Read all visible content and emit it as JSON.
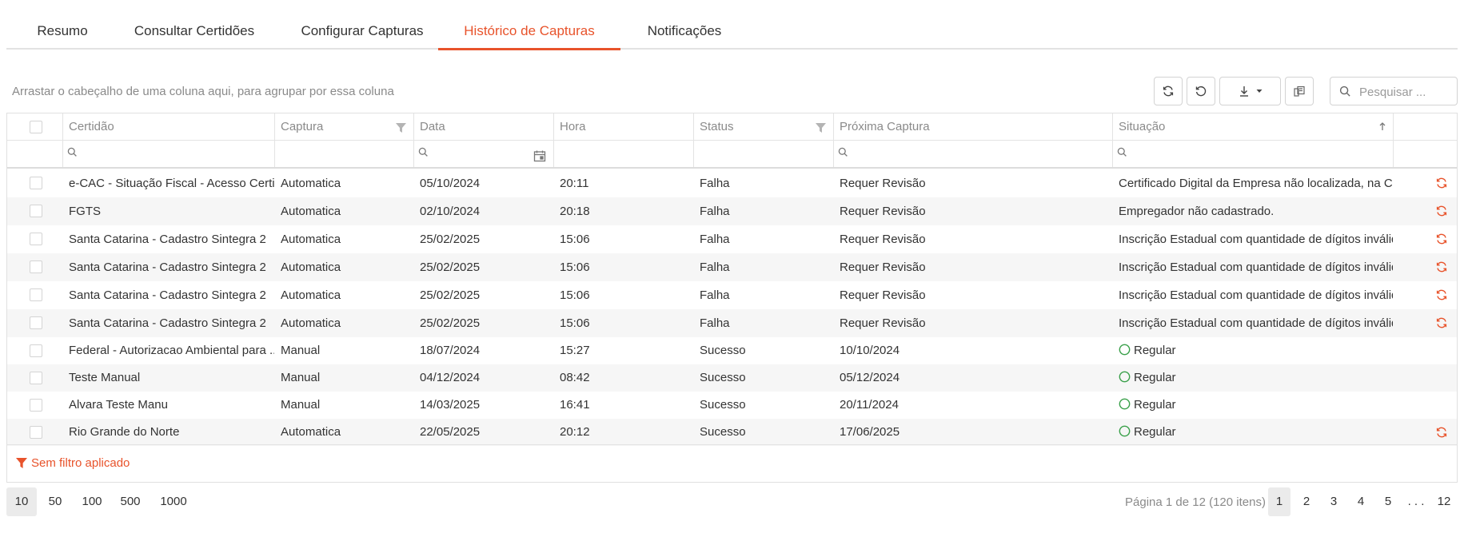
{
  "tabs": [
    "Resumo",
    "Consultar Certidões",
    "Configurar Capturas",
    "Histórico de Capturas",
    "Notificações"
  ],
  "active_tab": "Histórico de Capturas",
  "accent_color": "#e8532b",
  "toolbar": {
    "group_hint": "Arrastar o cabeçalho de uma coluna aqui, para agrupar por essa coluna",
    "search_placeholder": "Pesquisar ...",
    "buttons": [
      "refresh-icon",
      "reset-icon",
      "download-icon",
      "column-chooser-icon"
    ]
  },
  "grid": {
    "columns": [
      "Certidão",
      "Captura",
      "Data",
      "Hora",
      "Status",
      "Próxima Captura",
      "Situação"
    ],
    "rows": [
      {
        "certidao": "e-CAC - Situação Fiscal - Acesso Certif...",
        "captura": "Automatica",
        "data": "05/10/2024",
        "hora": "20:11",
        "status": "Falha",
        "proxima": "Requer Revisão",
        "situacao": "Certificado Digital da Empresa não localizada, na Ce...",
        "regular": false,
        "refresh": true
      },
      {
        "certidao": "FGTS",
        "captura": "Automatica",
        "data": "02/10/2024",
        "hora": "20:18",
        "status": "Falha",
        "proxima": "Requer Revisão",
        "situacao": "Empregador não cadastrado.",
        "regular": false,
        "refresh": true
      },
      {
        "certidao": "Santa Catarina - Cadastro Sintegra 2",
        "captura": "Automatica",
        "data": "25/02/2025",
        "hora": "15:06",
        "status": "Falha",
        "proxima": "Requer Revisão",
        "situacao": "Inscrição Estadual com quantidade de dígitos inválida.",
        "regular": false,
        "refresh": true
      },
      {
        "certidao": "Santa Catarina - Cadastro Sintegra 2",
        "captura": "Automatica",
        "data": "25/02/2025",
        "hora": "15:06",
        "status": "Falha",
        "proxima": "Requer Revisão",
        "situacao": "Inscrição Estadual com quantidade de dígitos inválida.",
        "regular": false,
        "refresh": true
      },
      {
        "certidao": "Santa Catarina - Cadastro Sintegra 2",
        "captura": "Automatica",
        "data": "25/02/2025",
        "hora": "15:06",
        "status": "Falha",
        "proxima": "Requer Revisão",
        "situacao": "Inscrição Estadual com quantidade de dígitos inválida.",
        "regular": false,
        "refresh": true
      },
      {
        "certidao": "Santa Catarina - Cadastro Sintegra 2",
        "captura": "Automatica",
        "data": "25/02/2025",
        "hora": "15:06",
        "status": "Falha",
        "proxima": "Requer Revisão",
        "situacao": "Inscrição Estadual com quantidade de dígitos inválida.",
        "regular": false,
        "refresh": true
      },
      {
        "certidao": "Federal - Autorizacao Ambiental para ...",
        "captura": "Manual",
        "data": "18/07/2024",
        "hora": "15:27",
        "status": "Sucesso",
        "proxima": "10/10/2024",
        "situacao": "Regular",
        "regular": true,
        "refresh": false
      },
      {
        "certidao": "Teste Manual",
        "captura": "Manual",
        "data": "04/12/2024",
        "hora": "08:42",
        "status": "Sucesso",
        "proxima": "05/12/2024",
        "situacao": "Regular",
        "regular": true,
        "refresh": false
      },
      {
        "certidao": "Alvara Teste Manu",
        "captura": "Manual",
        "data": "14/03/2025",
        "hora": "16:41",
        "status": "Sucesso",
        "proxima": "20/11/2024",
        "situacao": "Regular",
        "regular": true,
        "refresh": false
      },
      {
        "certidao": "Rio Grande do Norte",
        "captura": "Automatica",
        "data": "22/05/2025",
        "hora": "20:12",
        "status": "Sucesso",
        "proxima": "17/06/2025",
        "situacao": "Regular",
        "regular": true,
        "refresh": true
      }
    ],
    "filter_status": "Sem filtro aplicado"
  },
  "pager": {
    "page_sizes": [
      "10",
      "50",
      "100",
      "500",
      "1000"
    ],
    "selected_size": "10",
    "info": "Página 1 de 12 (120 itens)",
    "pages": [
      "1",
      "2",
      "3",
      "4",
      "5",
      ". . .",
      "12"
    ],
    "current_page": "1"
  }
}
